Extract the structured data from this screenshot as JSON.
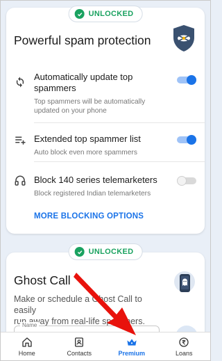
{
  "colors": {
    "accent": "#1a73e8",
    "unlocked": "#1aa260",
    "annotation": "#e8120c"
  },
  "spam_card": {
    "badge": "UNLOCKED",
    "title": "Powerful spam protection",
    "shield_icon": "shield-badge-icon",
    "rows": [
      {
        "title_line1": "Automatically update top",
        "title_line2": "spammers",
        "sub_line1": "Top spammers will be automatically",
        "sub_line2": "updated on your phone",
        "icon": "sync-icon",
        "toggle": "on"
      },
      {
        "title_line1": "Extended top spammer list",
        "sub_line1": "Auto block even more spammers",
        "icon": "playlist-add-icon",
        "toggle": "on"
      },
      {
        "title_line1": "Block 140 series telemarketers",
        "sub_line1": "Block registered Indian telemarketers",
        "icon": "headset-icon",
        "toggle": "off"
      }
    ],
    "more_link": "MORE BLOCKING OPTIONS"
  },
  "ghost_card": {
    "badge": "UNLOCKED",
    "title": "Ghost Call",
    "subtitle_line1": "Make or schedule a Ghost Call to easily",
    "subtitle_line2": "run away from real-life spammers.",
    "name_label": "Name"
  },
  "nav": [
    {
      "label": "Home",
      "icon": "home-icon"
    },
    {
      "label": "Contacts",
      "icon": "contacts-icon"
    },
    {
      "label": "Premium",
      "icon": "crown-icon",
      "active": true
    },
    {
      "label": "Loans",
      "icon": "rupee-icon"
    }
  ]
}
